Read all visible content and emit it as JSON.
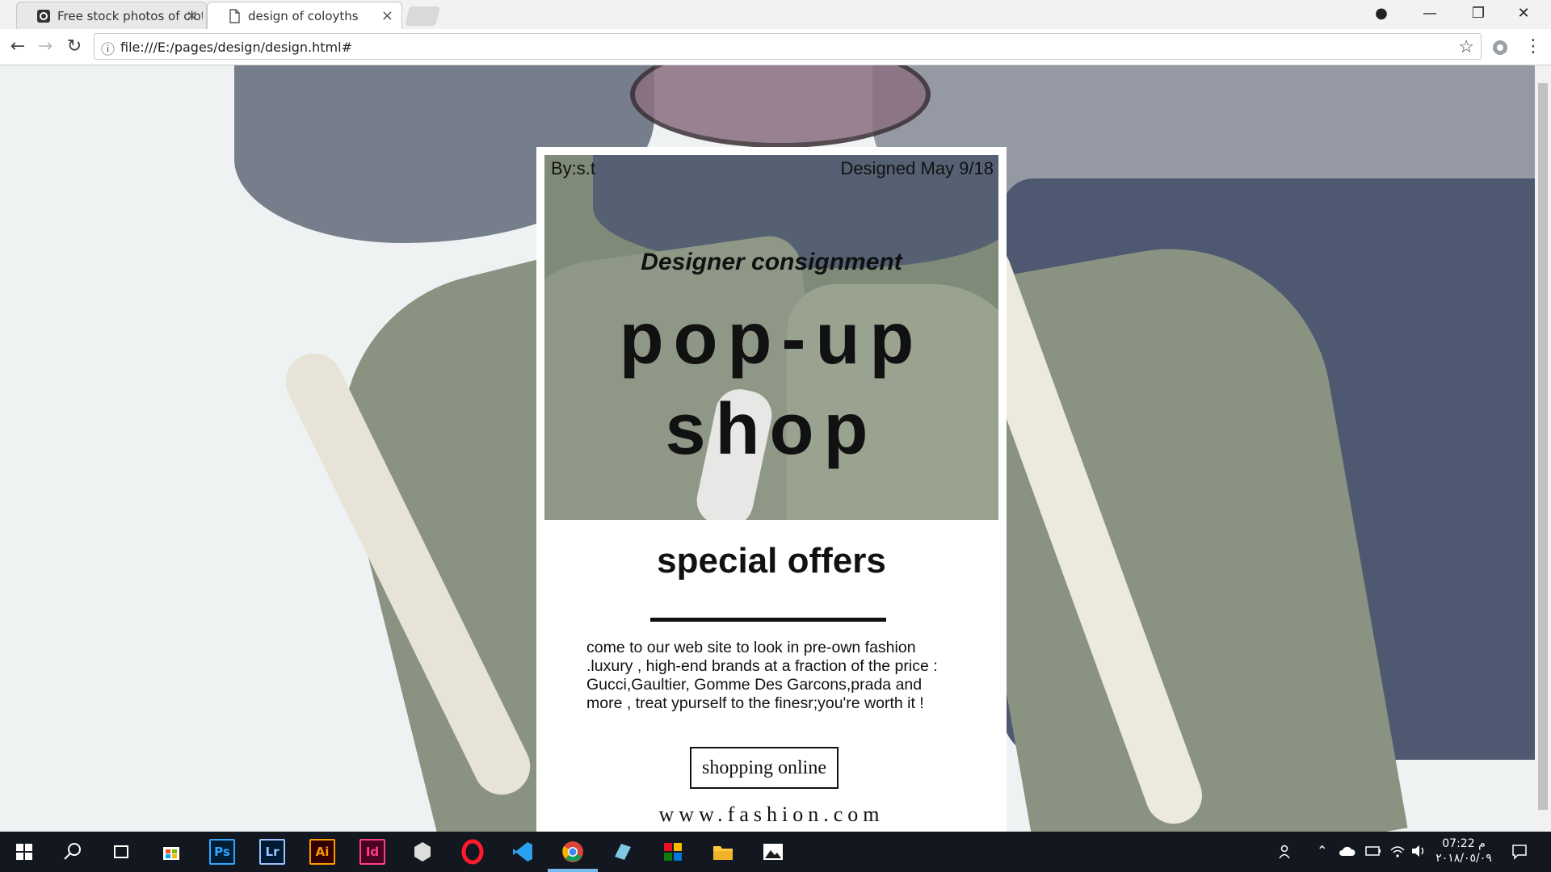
{
  "browser": {
    "tabs": [
      {
        "title": "Free stock photos of clot",
        "icon": "camera-icon"
      },
      {
        "title": "design of coloyths",
        "icon": "page-icon"
      }
    ],
    "url": "file:///E:/pages/design/design.html#",
    "icons": {
      "back": "←",
      "forward": "→",
      "reload": "↻",
      "info": "ⓘ",
      "star": "☆",
      "menu": "⋮",
      "tab_close": "×",
      "profile": "●",
      "minimize": "—",
      "restore": "❐",
      "close": "✕"
    }
  },
  "poster": {
    "byline": "By:s.t",
    "designed": "Designed May 9/18",
    "subtitle": "Designer consignment",
    "title_line1": "pop-up",
    "title_line2": "shop",
    "offers": "special offers",
    "description": "come to our web site to look in pre-own fashion .luxury , high-end brands at a fraction of the price : Gucci,Gaultier, Gomme Des Garcons,prada and more , treat ypurself to the finesr;you're worth it !",
    "cta": "shopping online",
    "website": "www.fashion.com"
  },
  "taskbar": {
    "apps": [
      {
        "name": "windows-start",
        "label": ""
      },
      {
        "name": "search",
        "label": ""
      },
      {
        "name": "task-view",
        "label": ""
      },
      {
        "name": "store",
        "label": ""
      },
      {
        "name": "photoshop",
        "label": "Ps",
        "color": "#31a8ff"
      },
      {
        "name": "lightroom",
        "label": "Lr",
        "color": "#9cc4ff"
      },
      {
        "name": "illustrator",
        "label": "Ai",
        "color": "#ff9a00"
      },
      {
        "name": "indesign",
        "label": "Id",
        "color": "#ff3d8b"
      },
      {
        "name": "app-hex",
        "label": ""
      },
      {
        "name": "opera",
        "label": "O",
        "color": "#ff1b2d"
      },
      {
        "name": "vscode",
        "label": ""
      },
      {
        "name": "chrome",
        "label": ""
      },
      {
        "name": "app-blue",
        "label": ""
      },
      {
        "name": "app-tiles",
        "label": ""
      },
      {
        "name": "file-explorer",
        "label": ""
      },
      {
        "name": "photos",
        "label": ""
      }
    ],
    "time": "07:22 م",
    "date": "٢٠١٨/٠٥/٠٩"
  }
}
